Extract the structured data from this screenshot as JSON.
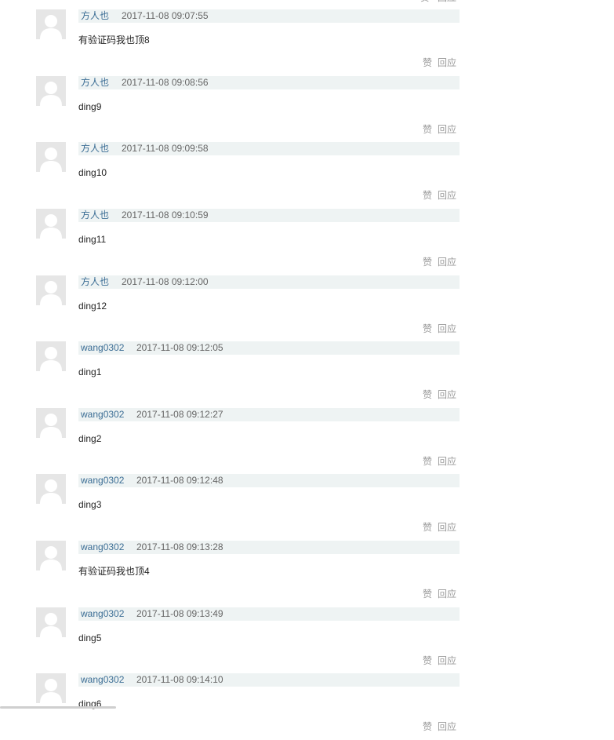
{
  "actions": {
    "like_label": "赞",
    "reply_label": "回应"
  },
  "comments": [
    {
      "author": "方人也",
      "time": "2017-11-08 09:07:55",
      "text": "有验证码我也顶8"
    },
    {
      "author": "方人也",
      "time": "2017-11-08 09:08:56",
      "text": "ding9"
    },
    {
      "author": "方人也",
      "time": "2017-11-08 09:09:58",
      "text": "ding10"
    },
    {
      "author": "方人也",
      "time": "2017-11-08 09:10:59",
      "text": "ding11"
    },
    {
      "author": "方人也",
      "time": "2017-11-08 09:12:00",
      "text": "ding12"
    },
    {
      "author": "wang0302",
      "time": "2017-11-08 09:12:05",
      "text": "ding1"
    },
    {
      "author": "wang0302",
      "time": "2017-11-08 09:12:27",
      "text": "ding2"
    },
    {
      "author": "wang0302",
      "time": "2017-11-08 09:12:48",
      "text": "ding3"
    },
    {
      "author": "wang0302",
      "time": "2017-11-08 09:13:28",
      "text": "有验证码我也顶4"
    },
    {
      "author": "wang0302",
      "time": "2017-11-08 09:13:49",
      "text": "ding5"
    },
    {
      "author": "wang0302",
      "time": "2017-11-08 09:14:10",
      "text": "ding6"
    }
  ]
}
